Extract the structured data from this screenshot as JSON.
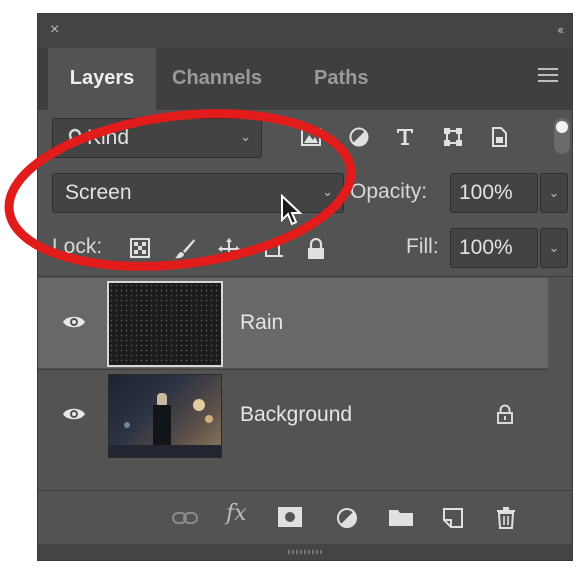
{
  "window": {
    "close_glyph": "×",
    "collapse_glyph": "‹‹"
  },
  "tabs": [
    {
      "label": "Layers",
      "active": true
    },
    {
      "label": "Channels",
      "active": false
    },
    {
      "label": "Paths",
      "active": false
    }
  ],
  "filter": {
    "kind_label": "Kind",
    "icons": [
      "image-filter-icon",
      "adjustment-filter-icon",
      "type-filter-icon",
      "shape-filter-icon",
      "smart-object-filter-icon"
    ]
  },
  "blend": {
    "mode": "Screen",
    "opacity_label": "Opacity:",
    "opacity_value": "100%"
  },
  "lock": {
    "label": "Lock:",
    "icons": [
      "lock-transparent-pixels-icon",
      "lock-image-pixels-icon",
      "lock-position-icon",
      "prevent-auto-nesting-icon",
      "lock-all-icon"
    ],
    "fill_label": "Fill:",
    "fill_value": "100%"
  },
  "layers": [
    {
      "name": "Rain",
      "selected": true,
      "visible": true,
      "locked": false
    },
    {
      "name": "Background",
      "selected": false,
      "visible": true,
      "locked": true
    }
  ],
  "bottom_toolbar": [
    "link-layers-icon",
    "add-layer-style-icon",
    "add-mask-icon",
    "new-adjustment-layer-icon",
    "new-group-icon",
    "new-layer-icon",
    "delete-layer-icon"
  ],
  "bottom_fx_label": "fx",
  "colors": {
    "panel_bg": "#535353",
    "tab_bar_bg": "#3f3f3f",
    "field_bg": "#434343",
    "selected_row": "#686868",
    "annotation_red": "#e21b1b"
  }
}
